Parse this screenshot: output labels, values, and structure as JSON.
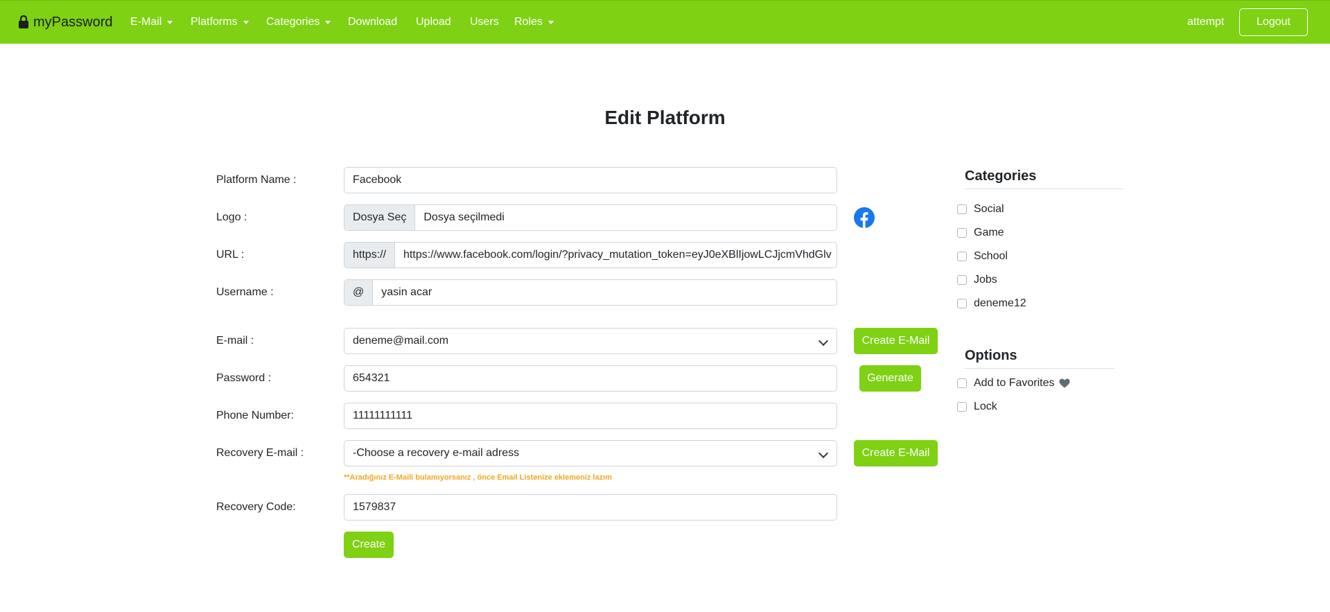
{
  "navbar": {
    "brand": "myPassword",
    "menu": [
      {
        "label": "E-Mail",
        "dropdown": true
      },
      {
        "label": "Platforms",
        "dropdown": true
      },
      {
        "label": "Categories",
        "dropdown": true
      },
      {
        "label": "Download",
        "dropdown": false
      },
      {
        "label": "Upload",
        "dropdown": false
      },
      {
        "label": "Users",
        "dropdown": false
      },
      {
        "label": "Roles",
        "dropdown": true
      }
    ],
    "user": "attempt",
    "logout_label": "Logout"
  },
  "page": {
    "title": "Edit Platform"
  },
  "form": {
    "platform_name": {
      "label": "Platform Name :",
      "value": "Facebook"
    },
    "logo": {
      "label": "Logo :",
      "button": "Dosya Seç",
      "status": "Dosya seçilmedi",
      "preview_icon": "facebook-icon"
    },
    "url": {
      "label": "URL :",
      "prefix": "https://",
      "value": "https://www.facebook.com/login/?privacy_mutation_token=eyJ0eXBlIjowLCJjcmVhdGlv"
    },
    "username": {
      "label": "Username :",
      "prefix": "@",
      "value": "yasin acar"
    },
    "email": {
      "label": "E-mail :",
      "selected": "deneme@mail.com",
      "button": "Create E-Mail"
    },
    "password": {
      "label": "Password :",
      "value": "654321",
      "button": "Generate"
    },
    "phone": {
      "label": "Phone Number:",
      "value": "11111111111"
    },
    "recovery_email": {
      "label": "Recovery E-mail :",
      "selected": "-Choose a recovery e-mail adress",
      "button": "Create E-Mail",
      "hint": "**Aradığınız E-Maili bulamıyorsanız , önce Email Listenize eklemeniz lazım"
    },
    "recovery_code": {
      "label": "Recovery Code:",
      "value": "1579837"
    },
    "submit_label": "Create"
  },
  "sidebar": {
    "categories_heading": "Categories",
    "categories": [
      "Social",
      "Game",
      "School",
      "Jobs",
      "deneme12"
    ],
    "options_heading": "Options",
    "options": [
      "Add to Favorites",
      "Lock"
    ]
  },
  "colors": {
    "accent": "#7ed113",
    "hint": "#f5a623",
    "facebook": "#1877f2"
  }
}
